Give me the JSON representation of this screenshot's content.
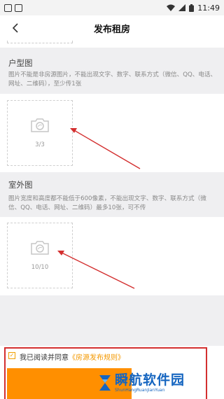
{
  "status_bar": {
    "time": "11:49"
  },
  "nav": {
    "title": "发布租房"
  },
  "floor_plan": {
    "title": "户型图",
    "description": "图片不能是非房源图片，不能出现文字、数字、联系方式（微信、QQ、电话、网址、二维码），至少传1张",
    "count": "3/3"
  },
  "exterior": {
    "title": "室外图",
    "description": "图片宽度和高度都不能低于600像素，不能出现文字、数字、联系方式（微信、QQ、电话、网址、二维码）最多10张，可不传",
    "count": "10/10"
  },
  "agreement": {
    "text": "我已阅读并同意",
    "link": "《房源发布规则》",
    "checked": true
  },
  "watermark": {
    "title": "瞬航软件园",
    "subtitle": "ShunHangRuanJianYuan"
  },
  "colors": {
    "accent": "#ff8f00",
    "annotation": "#d32f2f",
    "watermark": "#1565c0"
  }
}
